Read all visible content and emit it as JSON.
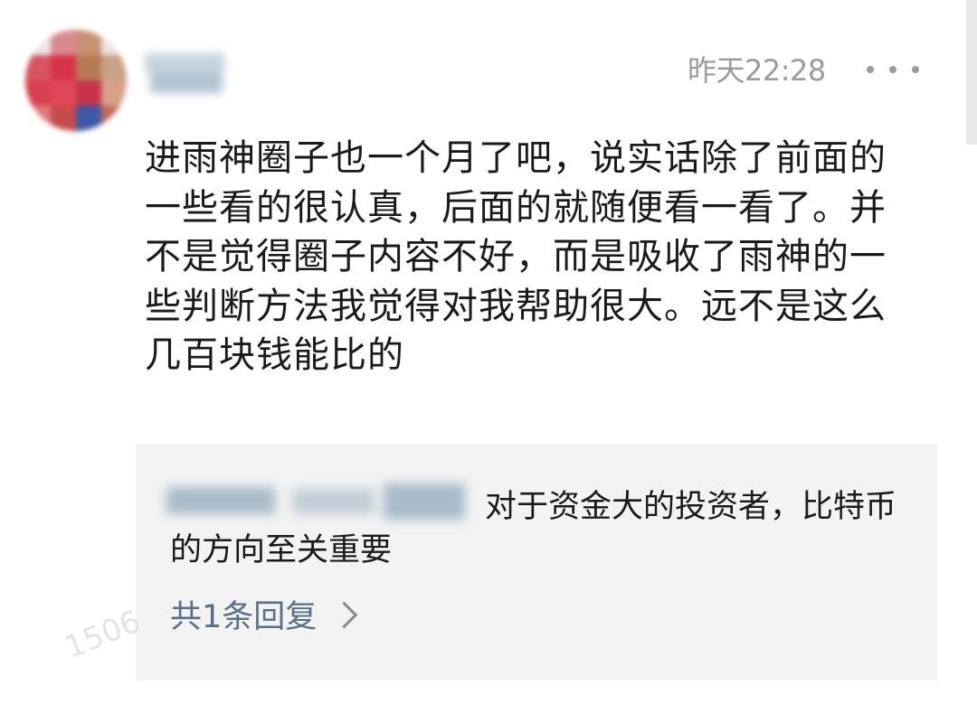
{
  "comment": {
    "timestamp": "昨天22:28",
    "text": "进雨神圈子也一个月了吧，说实话除了前面的一些看的很认真，后面的就随便看一看了。并不是觉得圈子内容不好，而是吸收了雨神的一些判断方法我觉得对我帮助很大。远不是这么几百块钱能比的",
    "more_icon": "more-dots-icon"
  },
  "reply": {
    "text": "对于资金大的投资者，比特币的方向至关重要",
    "count_label": "共1条回复",
    "arrow_icon": "chevron-right-icon"
  },
  "watermark": "1506",
  "colors": {
    "timestamp": "#9b9b9b",
    "text": "#1a1a1a",
    "reply_bg": "#f3f3f3",
    "link": "#57708a"
  }
}
